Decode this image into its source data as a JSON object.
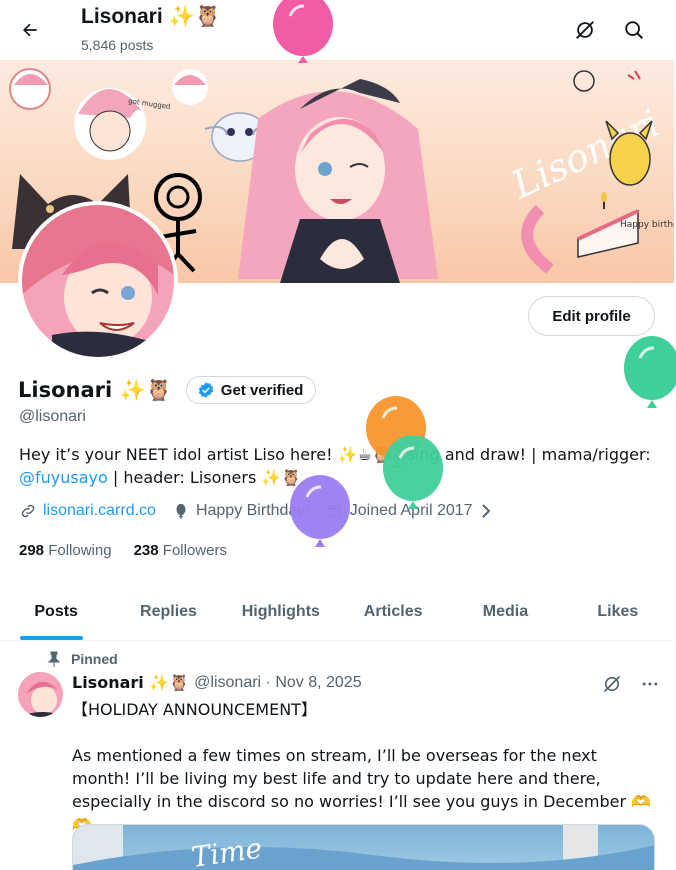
{
  "header": {
    "title": "Lisonari ✨🦉",
    "posts_count": "5,846 posts"
  },
  "profile": {
    "name": "Lisonari ✨🦉",
    "verify_label": "Get verified",
    "handle": "@lisonari",
    "edit_label": "Edit profile",
    "bio_part1": "Hey it’s your NEET idol artist Liso here! ✨☕🦉 I sing and draw! | mama/rigger: ",
    "bio_link": "@fuyusayo",
    "bio_part2": " | header: Lisoners ✨🦉",
    "website": "lisonari.carrd.co",
    "birthday": "Happy Birthday!",
    "joined": "Joined April 2017",
    "following_count": "298",
    "following_label": "Following",
    "followers_count": "238",
    "followers_label": "Followers"
  },
  "banner": {
    "signature": "Lisonari",
    "birthday_note": "Happy birthday, Liso",
    "doodle_note": "got mugged"
  },
  "tabs": [
    {
      "label": "Posts",
      "active": true
    },
    {
      "label": "Replies"
    },
    {
      "label": "Highlights"
    },
    {
      "label": "Articles"
    },
    {
      "label": "Media"
    },
    {
      "label": "Likes"
    }
  ],
  "post": {
    "pinned_label": "Pinned",
    "author": "Lisonari ✨🦉",
    "meta": "@lisonari · Nov 8, 2025",
    "text": "【HOLIDAY ANNOUNCEMENT】\n\nAs mentioned a few times on stream, I’ll be overseas for the next month! I’ll be living my best life and try to update here and there, especially in the discord so no worries! I’ll see you guys in December 🫶🫶",
    "media_caption": "Time"
  },
  "colors": {
    "accent": "#1d9bf0",
    "balloon_pink": "#f25ca4",
    "balloon_teal": "#3fcf9a",
    "balloon_orange": "#f7952c",
    "balloon_purple": "#9b7cf2"
  }
}
